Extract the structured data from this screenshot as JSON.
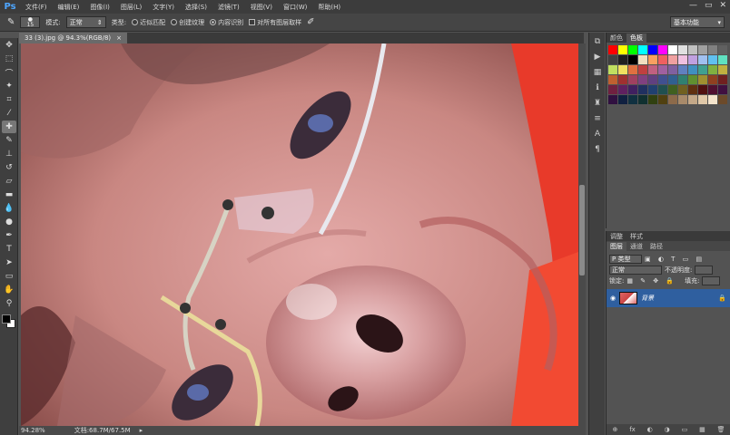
{
  "app": {
    "logo": "Ps"
  },
  "menu": [
    "文件(F)",
    "编辑(E)",
    "图像(I)",
    "图层(L)",
    "文字(Y)",
    "选择(S)",
    "滤镜(T)",
    "视图(V)",
    "窗口(W)",
    "帮助(H)"
  ],
  "window_controls": [
    "—",
    "▭",
    "✕"
  ],
  "options": {
    "brush_size": "15",
    "mode_label": "模式:",
    "mode_value": "正常",
    "type_label": "类型:",
    "radio1": "近似匹配",
    "radio2": "创建纹理",
    "radio3": "内容识别",
    "checkbox_label": "对所有图层取样",
    "workspace": "基本功能"
  },
  "document": {
    "tab_title": "33 (3).jpg @ 94.3%(RGB/8)",
    "tab_close": "×",
    "zoom": "94.28%",
    "doc_info": "文档:68.7M/67.5M"
  },
  "color_panel": {
    "tabs": [
      "颜色",
      "色板"
    ],
    "swatches": [
      "#ff0000",
      "#ffff00",
      "#00ff00",
      "#00ffff",
      "#0000ff",
      "#ff00ff",
      "#ffffff",
      "#e0e0e0",
      "#c0c0c0",
      "#a0a0a0",
      "#808080",
      "#606060",
      "#404040",
      "#202020",
      "#000000",
      "#f0e0c0",
      "#f8a060",
      "#f06060",
      "#f0a0a0",
      "#f0c0e0",
      "#c0a0e0",
      "#a0c0f0",
      "#60c0f0",
      "#60e0c0",
      "#c0e060",
      "#f0e060",
      "#e07040",
      "#c04040",
      "#c06080",
      "#a060a0",
      "#8060a0",
      "#6080c0",
      "#4090c0",
      "#40a090",
      "#80b040",
      "#c0b040",
      "#c06030",
      "#a03030",
      "#a04060",
      "#804080",
      "#604080",
      "#405090",
      "#306090",
      "#308070",
      "#609030",
      "#a09030",
      "#904020",
      "#702020",
      "#702040",
      "#602060",
      "#402060",
      "#203060",
      "#204070",
      "#205050",
      "#406020",
      "#706020",
      "#603010",
      "#501010",
      "#501030",
      "#401040",
      "#301040",
      "#102040",
      "#103040",
      "#103030",
      "#304010",
      "#504010",
      "#8c6a4a",
      "#a88a6a",
      "#c4a888",
      "#e0c8a8",
      "#f4e4cc",
      "#6c4a2a"
    ]
  },
  "layers_panel": {
    "tabs": [
      "调整",
      "样式"
    ],
    "sub_tabs": [
      "图层",
      "通道",
      "路径"
    ],
    "kind_label": "P 类型",
    "blend_mode": "正常",
    "opacity_label": "不透明度:",
    "lock_label": "锁定:",
    "fill_label": "填充:",
    "layer_name": "背景",
    "footer_icons": [
      "⊕",
      "fx",
      "◐",
      "◑",
      "▭",
      "▦",
      "🗑"
    ]
  },
  "toolbar_tools": [
    "move-tool-icon",
    "marquee-tool-icon",
    "lasso-tool-icon",
    "quick-select-icon",
    "crop-tool-icon",
    "eyedropper-icon",
    "spot-healing-icon",
    "brush-tool-icon",
    "clone-stamp-icon",
    "history-brush-icon",
    "eraser-icon",
    "gradient-icon",
    "blur-icon",
    "dodge-icon",
    "pen-icon",
    "type-icon",
    "path-select-icon",
    "shape-icon",
    "hand-icon",
    "zoom-icon"
  ]
}
